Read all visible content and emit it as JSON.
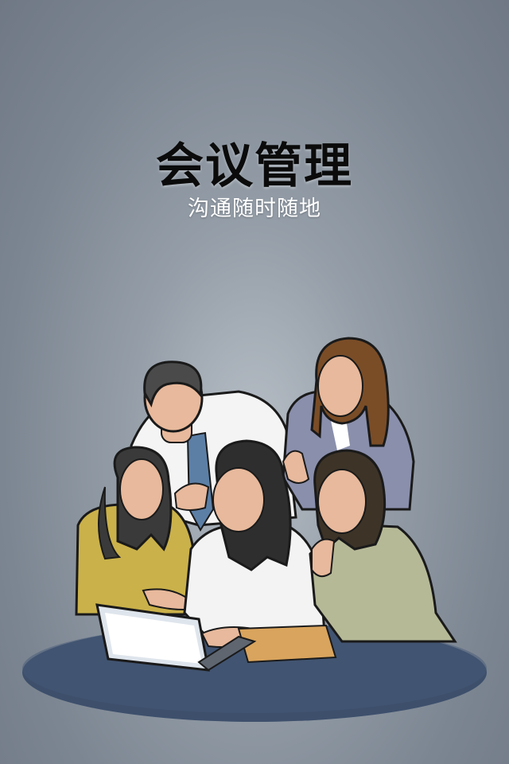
{
  "splash": {
    "title": "会议管理",
    "subtitle": "沟通随时随地"
  },
  "colors": {
    "background_top": "#a1a8b0",
    "background_bottom": "#6f7884",
    "table": "#3d4f6b",
    "title_text": "#0b0b0b",
    "subtitle_text": "#ffffff"
  },
  "illustration": {
    "icon": "business-team-meeting-illustration"
  }
}
